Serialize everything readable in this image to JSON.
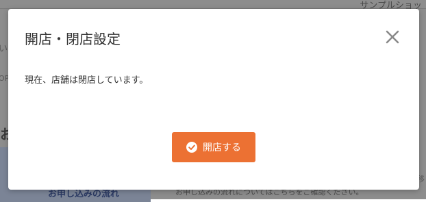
{
  "background": {
    "shop_name": "サンプルショッ",
    "left_fragment_1": "い",
    "left_fragment_2": "OP",
    "left_fragment_3": "お",
    "flow_label": "お申し込みの流れ",
    "bottom_text": "お申し込みの流れについてはこちらをご確認ください。",
    "right_fragment": "移"
  },
  "modal": {
    "title": "開店・閉店設定",
    "message": "現在、店舗は閉店しています。",
    "open_button_label": "開店する",
    "close_icon": "close-icon",
    "check_icon": "check-circle-icon"
  },
  "colors": {
    "accent": "#ec7133",
    "overlay": "#8d8d8d",
    "text": "#333333"
  }
}
